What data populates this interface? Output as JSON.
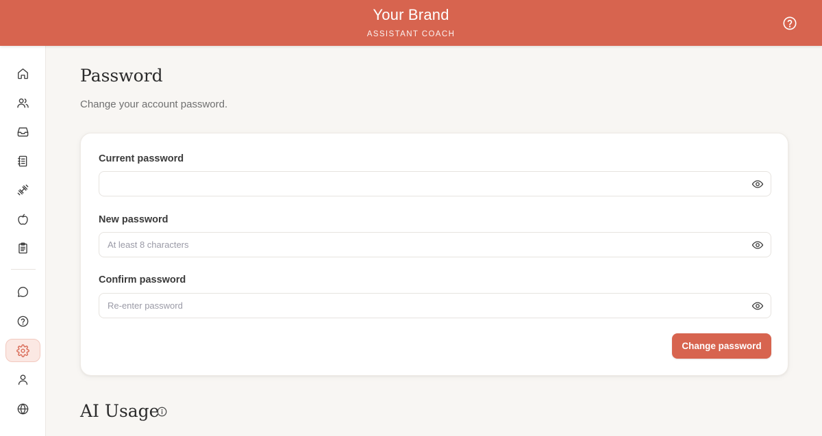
{
  "header": {
    "brand": "Your Brand",
    "role": "ASSISTANT COACH",
    "help_icon": "help-circle-icon",
    "background": "#d7644f"
  },
  "sidebar": {
    "items": [
      {
        "icon": "home-icon"
      },
      {
        "icon": "users-icon"
      },
      {
        "icon": "inbox-icon"
      },
      {
        "icon": "notebook-icon"
      },
      {
        "icon": "dumbbell-icon"
      },
      {
        "icon": "apple-icon"
      },
      {
        "icon": "clipboard-icon"
      },
      {
        "icon": "chat-bubble-icon"
      },
      {
        "icon": "help-circle-icon"
      },
      {
        "icon": "gear-icon",
        "active": true
      },
      {
        "icon": "user-icon"
      },
      {
        "icon": "globe-icon"
      }
    ],
    "active_color": "#d7644f"
  },
  "password_section": {
    "title": "Password",
    "description": "Change your account password.",
    "fields": {
      "current": {
        "label": "Current password",
        "value": "",
        "placeholder": ""
      },
      "new": {
        "label": "New password",
        "value": "",
        "placeholder": "At least 8 characters"
      },
      "confirm": {
        "label": "Confirm password",
        "value": "",
        "placeholder": "Re-enter password"
      }
    },
    "submit_label": "Change password"
  },
  "ai_usage_section": {
    "title": "AI Usage",
    "info_icon": "info-icon"
  }
}
